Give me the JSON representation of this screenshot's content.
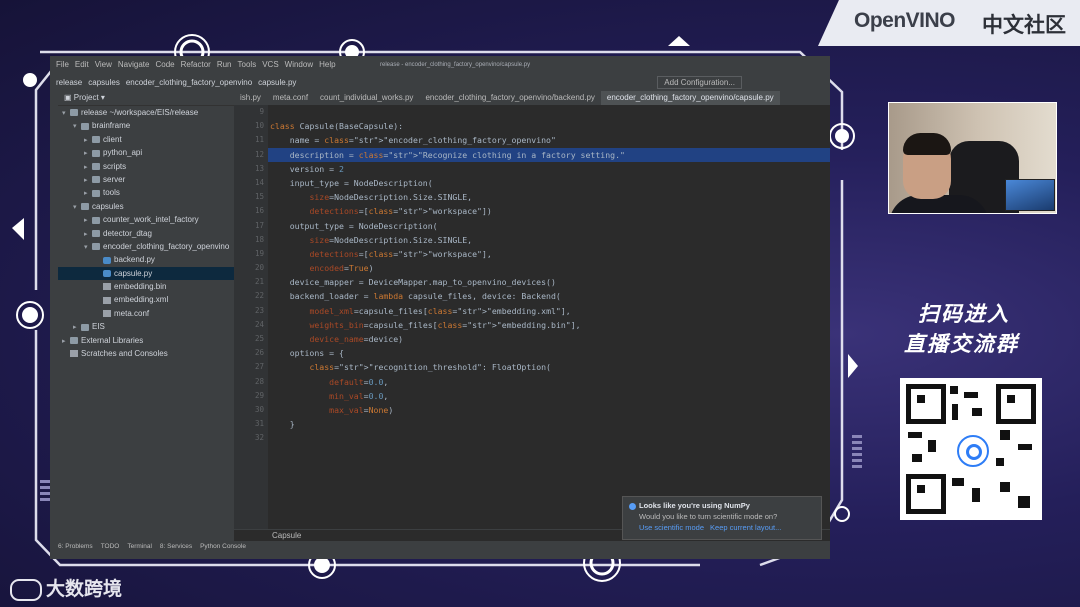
{
  "brand": {
    "logo": "OpenVINO",
    "logo_cn": "中文社区",
    "watermark": "大数跨境"
  },
  "ide": {
    "window_title": "release - encoder_clothing_factory_openvino/capsule.py",
    "menu": [
      "File",
      "Edit",
      "View",
      "Navigate",
      "Code",
      "Refactor",
      "Run",
      "Tools",
      "VCS",
      "Window",
      "Help"
    ],
    "navbar": [
      "release",
      "capsules",
      "encoder_clothing_factory_openvino",
      "capsule.py"
    ],
    "add_configuration": "Add Configuration...",
    "project_header": "Project",
    "tree": [
      {
        "label": "release ~/workspace/EIS/release",
        "depth": 0,
        "type": "folder",
        "open": true
      },
      {
        "label": "brainframe",
        "depth": 1,
        "type": "folder",
        "open": true
      },
      {
        "label": "client",
        "depth": 2,
        "type": "folder",
        "open": false
      },
      {
        "label": "python_api",
        "depth": 2,
        "type": "folder",
        "open": false
      },
      {
        "label": "scripts",
        "depth": 2,
        "type": "folder",
        "open": false
      },
      {
        "label": "server",
        "depth": 2,
        "type": "folder",
        "open": false
      },
      {
        "label": "tools",
        "depth": 2,
        "type": "folder",
        "open": false
      },
      {
        "label": "capsules",
        "depth": 1,
        "type": "folder",
        "open": true
      },
      {
        "label": "counter_work_intel_factory",
        "depth": 2,
        "type": "folder",
        "open": false
      },
      {
        "label": "detector_dtag",
        "depth": 2,
        "type": "folder",
        "open": false
      },
      {
        "label": "encoder_clothing_factory_openvino",
        "depth": 2,
        "type": "folder",
        "open": true
      },
      {
        "label": "backend.py",
        "depth": 3,
        "type": "py"
      },
      {
        "label": "capsule.py",
        "depth": 3,
        "type": "py",
        "selected": true
      },
      {
        "label": "embedding.bin",
        "depth": 3,
        "type": "file"
      },
      {
        "label": "embedding.xml",
        "depth": 3,
        "type": "file"
      },
      {
        "label": "meta.conf",
        "depth": 3,
        "type": "file"
      },
      {
        "label": "EIS",
        "depth": 1,
        "type": "folder",
        "open": false
      },
      {
        "label": "External Libraries",
        "depth": 0,
        "type": "folder",
        "open": false
      },
      {
        "label": "Scratches and Consoles",
        "depth": 0,
        "type": "file"
      }
    ],
    "tabs": [
      {
        "label": "ish.py",
        "active": false
      },
      {
        "label": "meta.conf",
        "active": false
      },
      {
        "label": "count_individual_works.py",
        "active": false
      },
      {
        "label": "encoder_clothing_factory_openvino/backend.py",
        "active": false
      },
      {
        "label": "encoder_clothing_factory_openvino/capsule.py",
        "active": true
      }
    ],
    "code": [
      {
        "n": "9",
        "t": ""
      },
      {
        "n": "10",
        "t": "class Capsule(BaseCapsule):"
      },
      {
        "n": "11",
        "t": "    name = \"encoder_clothing_factory_openvino\""
      },
      {
        "n": "12",
        "t": "    description = \"Recognize clothing in a factory setting.\"",
        "hl": true
      },
      {
        "n": "13",
        "t": "    version = 2"
      },
      {
        "n": "14",
        "t": "    input_type = NodeDescription("
      },
      {
        "n": "15",
        "t": "        size=NodeDescription.Size.SINGLE,"
      },
      {
        "n": "16",
        "t": "        detections=[\"workspace\"])"
      },
      {
        "n": "17",
        "t": "    output_type = NodeDescription("
      },
      {
        "n": "18",
        "t": "        size=NodeDescription.Size.SINGLE,"
      },
      {
        "n": "19",
        "t": "        detections=[\"workspace\"],"
      },
      {
        "n": "20",
        "t": "        encoded=True)"
      },
      {
        "n": "21",
        "t": "    device_mapper = DeviceMapper.map_to_openvino_devices()"
      },
      {
        "n": "22",
        "t": "    backend_loader = lambda capsule_files, device: Backend("
      },
      {
        "n": "23",
        "t": "        model_xml=capsule_files[\"embedding.xml\"],"
      },
      {
        "n": "24",
        "t": "        weights_bin=capsule_files[\"embedding.bin\"],"
      },
      {
        "n": "25",
        "t": "        device_name=device)"
      },
      {
        "n": "26",
        "t": "    options = {"
      },
      {
        "n": "27",
        "t": "        \"recognition_threshold\": FloatOption("
      },
      {
        "n": "28",
        "t": "            default=0.0,"
      },
      {
        "n": "29",
        "t": "            min_val=0.0,"
      },
      {
        "n": "30",
        "t": "            max_val=None)"
      },
      {
        "n": "31",
        "t": "    }"
      },
      {
        "n": "32",
        "t": ""
      }
    ],
    "breadcrumb": "Capsule",
    "toolwindows": [
      "6: Problems",
      "TODO",
      "Terminal",
      "8: Services",
      "Python Console"
    ],
    "notification": {
      "title": "Looks like you're using NumPy",
      "question": "Would you like to turn scientific mode on?",
      "link1": "Use scientific mode",
      "link2": "Keep current layout..."
    }
  },
  "promo": {
    "line1": "扫码进入",
    "line2": "直播交流群"
  },
  "colors": {
    "accent": "#4a88c7",
    "bg": "#1b1845",
    "editor": "#2b2b2b",
    "highlight": "#214283"
  }
}
